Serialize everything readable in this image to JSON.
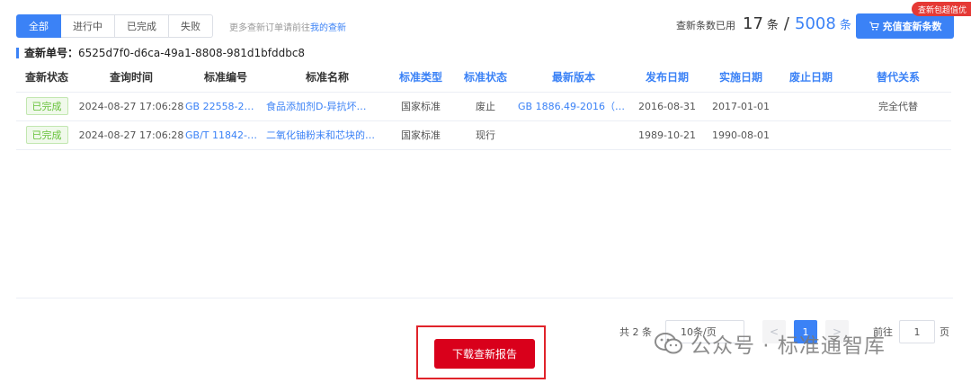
{
  "tabs": [
    "全部",
    "进行中",
    "已完成",
    "失败"
  ],
  "hint": {
    "prefix": "更多查新订单请前往",
    "link": "我的查新"
  },
  "quota": {
    "label": "查新条数已用",
    "used": "17",
    "unit": "条",
    "slash": "/",
    "total": "5008",
    "unit2": "条"
  },
  "recharge_label": "充值查新条数",
  "promo_badge": "查新包超值优",
  "order": {
    "label": "查新单号：",
    "value": "6525d7f0-d6ca-49a1-8808-981d1bfddbc8"
  },
  "table": {
    "headers": [
      "查新状态",
      "查询时间",
      "标准编号",
      "标准名称",
      "标准类型",
      "标准状态",
      "最新版本",
      "发布日期",
      "实施日期",
      "废止日期",
      "替代关系"
    ],
    "rows": [
      [
        "已完成",
        "2024-08-27 17:06:28",
        "GB 22558-2…",
        "食品添加剂D-异抗坏…",
        "国家标准",
        "废止",
        "GB 1886.49-2016（食…",
        "2016-08-31",
        "2017-01-01",
        "",
        "完全代替"
      ],
      [
        "已完成",
        "2024-08-27 17:06:28",
        "GB/T 11842-…",
        "二氧化铀粉末和芯块的…",
        "国家标准",
        "现行",
        "",
        "1989-10-21",
        "1990-08-01",
        "",
        ""
      ]
    ]
  },
  "download_label": "下载查新报告",
  "pagination": {
    "total": "共 2 条",
    "page_size": "10条/页",
    "prev": "<",
    "current": "1",
    "next": ">",
    "goto": "前往",
    "goto_value": "1",
    "page_unit": "页"
  },
  "watermark": "公众号 · 标准通智库",
  "colors": {
    "primary": "#3b82f6",
    "danger": "#d9001b",
    "success": "#67c23a"
  }
}
